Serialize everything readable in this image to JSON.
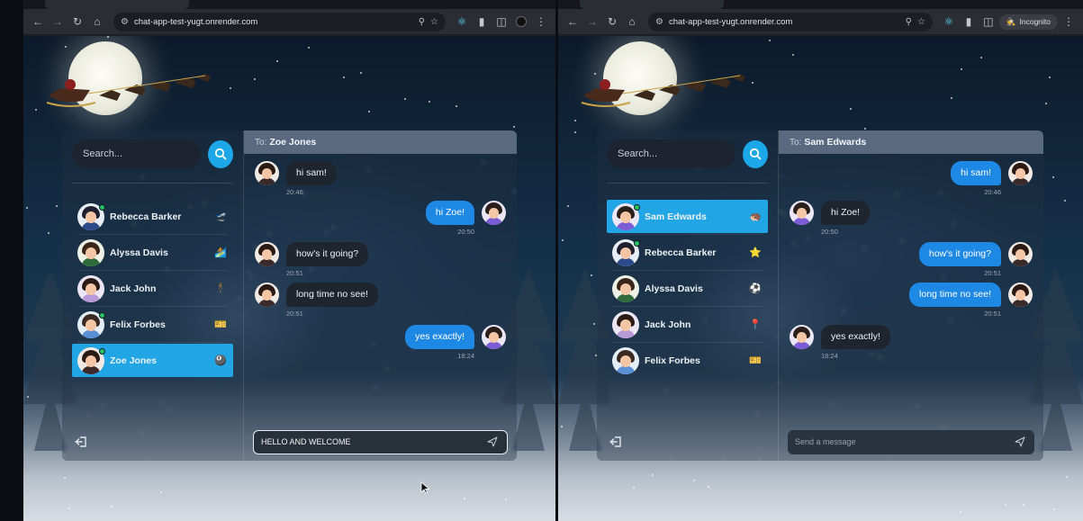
{
  "windows": [
    {
      "id": "left",
      "browser": {
        "url": "chat-app-test-yugt.onrender.com",
        "incognito_label": ""
      },
      "app": {
        "search_placeholder": "Search...",
        "chat_to_label": "To:",
        "chat_to_name": "Zoe Jones",
        "conversations": [
          {
            "name": "Rebecca Barker",
            "emoji": "🛫",
            "online": true,
            "active": false
          },
          {
            "name": "Alyssa Davis",
            "emoji": "🏄",
            "online": false,
            "active": false
          },
          {
            "name": "Jack John",
            "emoji": "🕴",
            "online": false,
            "active": false
          },
          {
            "name": "Felix Forbes",
            "emoji": "🎫",
            "online": true,
            "active": false
          },
          {
            "name": "Zoe Jones",
            "emoji": "🎱",
            "online": true,
            "active": true
          }
        ],
        "messages": [
          {
            "direction": "in",
            "text": "hi sam!",
            "time": "20:46"
          },
          {
            "direction": "out",
            "text": "hi Zoe!",
            "time": "20:50"
          },
          {
            "direction": "in",
            "text": "how's it going?",
            "time": "20:51"
          },
          {
            "direction": "in",
            "text": "long time no see!",
            "time": "20:51"
          },
          {
            "direction": "out",
            "text": "yes exactly!",
            "time": "18:24"
          }
        ],
        "composer_value": "HELLO AND WELCOME",
        "composer_placeholder": "Send a message"
      }
    },
    {
      "id": "right",
      "browser": {
        "url": "chat-app-test-yugt.onrender.com",
        "incognito_label": "Incognito"
      },
      "app": {
        "search_placeholder": "Search...",
        "chat_to_label": "To:",
        "chat_to_name": "Sam Edwards",
        "conversations": [
          {
            "name": "Sam Edwards",
            "emoji": "🦔",
            "online": true,
            "active": true
          },
          {
            "name": "Rebecca Barker",
            "emoji": "⭐",
            "online": true,
            "active": false
          },
          {
            "name": "Alyssa Davis",
            "emoji": "⚽",
            "online": false,
            "active": false
          },
          {
            "name": "Jack John",
            "emoji": "📍",
            "online": false,
            "active": false
          },
          {
            "name": "Felix Forbes",
            "emoji": "🎫",
            "online": false,
            "active": false
          }
        ],
        "messages": [
          {
            "direction": "out",
            "text": "hi sam!",
            "time": "20:46"
          },
          {
            "direction": "in",
            "text": "hi Zoe!",
            "time": "20:50"
          },
          {
            "direction": "out",
            "text": "how's it going?",
            "time": "20:51"
          },
          {
            "direction": "out",
            "text": "long time no see!",
            "time": "20:51"
          },
          {
            "direction": "in",
            "text": "yes exactly!",
            "time": "18:24"
          }
        ],
        "composer_value": "",
        "composer_placeholder": "Send a message"
      }
    }
  ]
}
